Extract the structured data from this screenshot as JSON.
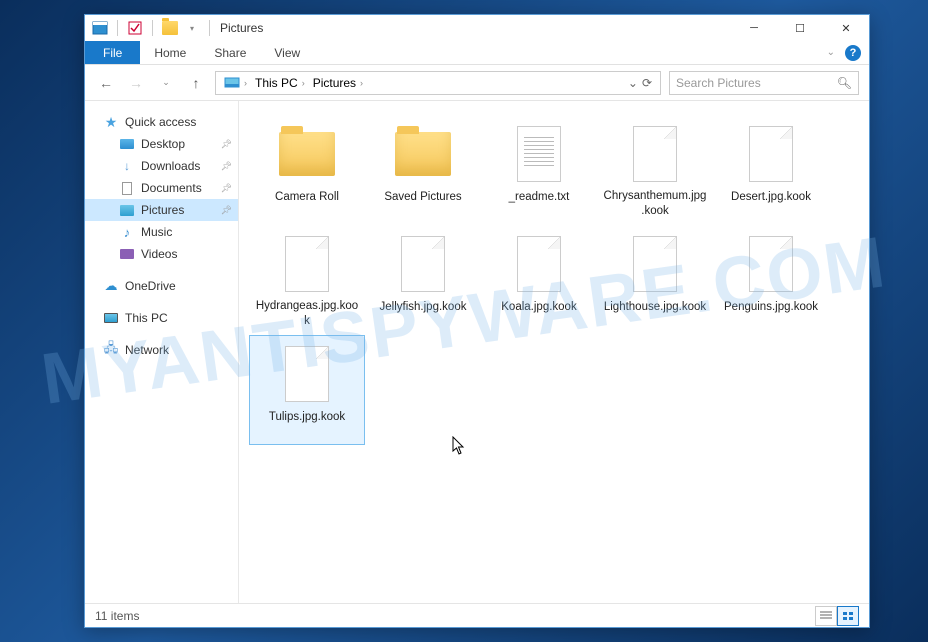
{
  "window": {
    "title": "Pictures"
  },
  "ribbon": {
    "file": "File",
    "tabs": [
      "Home",
      "Share",
      "View"
    ]
  },
  "breadcrumb": [
    "This PC",
    "Pictures"
  ],
  "search": {
    "placeholder": "Search Pictures"
  },
  "nav": {
    "quick_access": "Quick access",
    "quick_items": [
      {
        "label": "Desktop",
        "pinned": true
      },
      {
        "label": "Downloads",
        "pinned": true
      },
      {
        "label": "Documents",
        "pinned": true
      },
      {
        "label": "Pictures",
        "pinned": true,
        "selected": true
      },
      {
        "label": "Music",
        "pinned": false
      },
      {
        "label": "Videos",
        "pinned": false
      }
    ],
    "onedrive": "OneDrive",
    "this_pc": "This PC",
    "network": "Network"
  },
  "items": [
    {
      "name": "Camera Roll",
      "type": "folder"
    },
    {
      "name": "Saved Pictures",
      "type": "folder"
    },
    {
      "name": "_readme.txt",
      "type": "txt"
    },
    {
      "name": "Chrysanthemum.jpg.kook",
      "type": "blank"
    },
    {
      "name": "Desert.jpg.kook",
      "type": "blank"
    },
    {
      "name": "Hydrangeas.jpg.kook",
      "type": "blank"
    },
    {
      "name": "Jellyfish.jpg.kook",
      "type": "blank"
    },
    {
      "name": "Koala.jpg.kook",
      "type": "blank"
    },
    {
      "name": "Lighthouse.jpg.kook",
      "type": "blank"
    },
    {
      "name": "Penguins.jpg.kook",
      "type": "blank"
    },
    {
      "name": "Tulips.jpg.kook",
      "type": "blank",
      "selected": true
    }
  ],
  "status": {
    "count": "11 items"
  },
  "watermark": "MYANTISPYWARE.COM"
}
